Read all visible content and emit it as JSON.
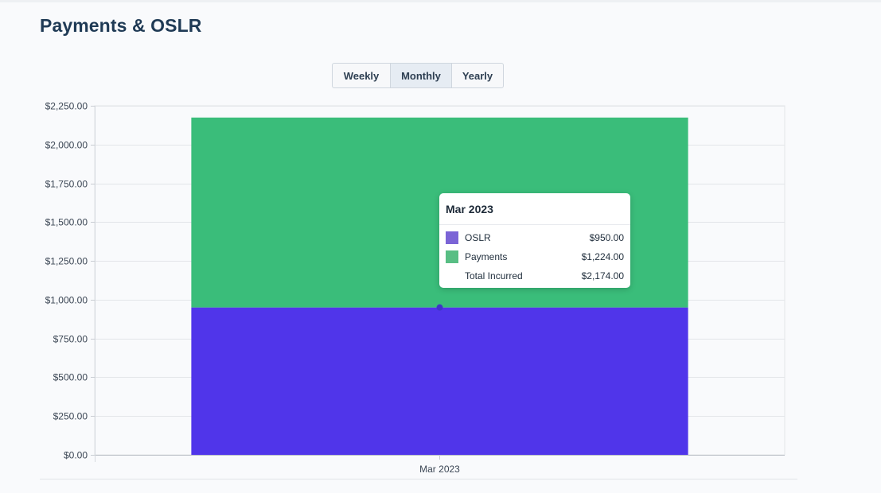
{
  "page": {
    "title": "Payments & OSLR"
  },
  "period_toggle": {
    "options": [
      "Weekly",
      "Monthly",
      "Yearly"
    ],
    "selected": "Monthly"
  },
  "chart_data": {
    "type": "bar",
    "stacked": true,
    "title": "",
    "xlabel": "",
    "ylabel": "",
    "categories": [
      "Mar 2023"
    ],
    "series": [
      {
        "name": "OSLR",
        "values": [
          950
        ],
        "color": "#5035ea"
      },
      {
        "name": "Payments",
        "values": [
          1224
        ],
        "color": "#3abd7a"
      }
    ],
    "ylim": [
      0,
      2250
    ],
    "yticks": [
      0,
      250,
      500,
      750,
      1000,
      1250,
      1500,
      1750,
      2000,
      2250
    ],
    "ytick_labels": [
      "$0.00",
      "$250.00",
      "$500.00",
      "$750.00",
      "$1,000.00",
      "$1,250.00",
      "$1,500.00",
      "$1,750.00",
      "$2,000.00",
      "$2,250.00"
    ],
    "grid": true,
    "legend": "none"
  },
  "tooltip": {
    "title": "Mar 2023",
    "rows": [
      {
        "label": "OSLR",
        "value": "$950.00",
        "color": "#7b64d6"
      },
      {
        "label": "Payments",
        "value": "$1,224.00",
        "color": "#58be84"
      },
      {
        "label": "Total Incurred",
        "value": "$2,174.00"
      }
    ]
  }
}
